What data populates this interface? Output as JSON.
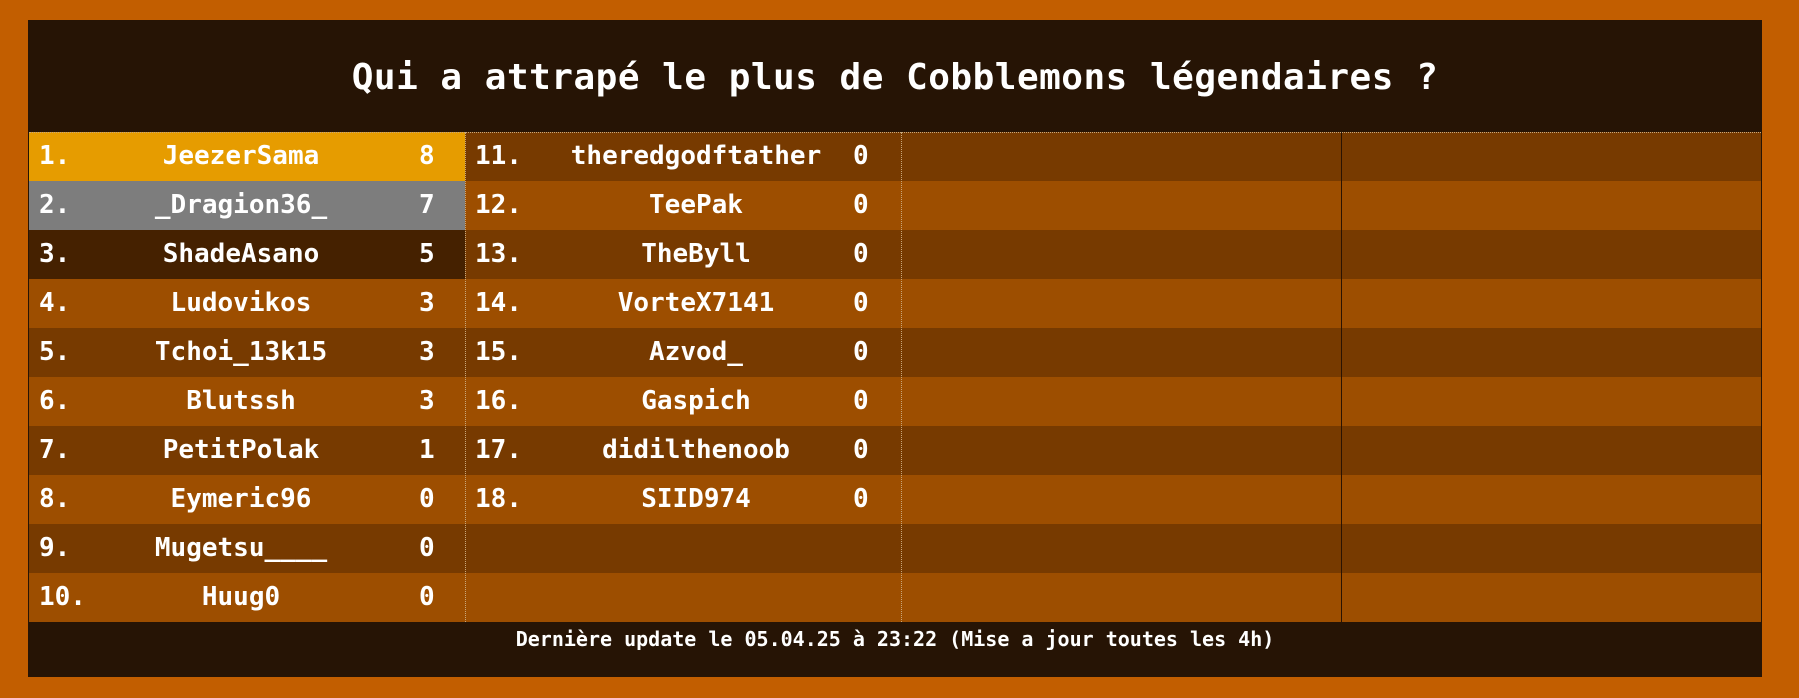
{
  "title": "Qui a attrapé le plus de Cobblemons légendaires ?",
  "columns": [
    [
      {
        "rank": "1.",
        "name": "JeezerSama",
        "score": "8"
      },
      {
        "rank": "2.",
        "name": "_Dragion36_",
        "score": "7"
      },
      {
        "rank": "3.",
        "name": "ShadeAsano",
        "score": "5"
      },
      {
        "rank": "4.",
        "name": "Ludovikos",
        "score": "3"
      },
      {
        "rank": "5.",
        "name": "Tchoi_13k15",
        "score": "3"
      },
      {
        "rank": "6.",
        "name": "Blutssh",
        "score": "3"
      },
      {
        "rank": "7.",
        "name": "PetitPolak",
        "score": "1"
      },
      {
        "rank": "8.",
        "name": "Eymeric96",
        "score": "0"
      },
      {
        "rank": "9.",
        "name": "Mugetsu____",
        "score": "0"
      },
      {
        "rank": "10.",
        "name": "Huug0",
        "score": "0"
      }
    ],
    [
      {
        "rank": "11.",
        "name": "theredgodftather",
        "score": "0"
      },
      {
        "rank": "12.",
        "name": "TeePak",
        "score": "0"
      },
      {
        "rank": "13.",
        "name": "TheByll",
        "score": "0"
      },
      {
        "rank": "14.",
        "name": "VorteX7141",
        "score": "0"
      },
      {
        "rank": "15.",
        "name": "Azvod_",
        "score": "0"
      },
      {
        "rank": "16.",
        "name": "Gaspich",
        "score": "0"
      },
      {
        "rank": "17.",
        "name": "didilthenoob",
        "score": "0"
      },
      {
        "rank": "18.",
        "name": "SIID974",
        "score": "0"
      },
      {
        "rank": "",
        "name": "",
        "score": ""
      },
      {
        "rank": "",
        "name": "",
        "score": ""
      }
    ]
  ],
  "footer": "Dernière update le 05.04.25 à 23:22 (Mise a jour toutes les 4h)",
  "colors": {
    "background": "#c25e00",
    "panel": "#261405",
    "row_dark": "#773a00",
    "row_light": "#9d4e00",
    "gold": "#e69c00",
    "silver": "#7d7d7d",
    "bronze": "#452100"
  }
}
